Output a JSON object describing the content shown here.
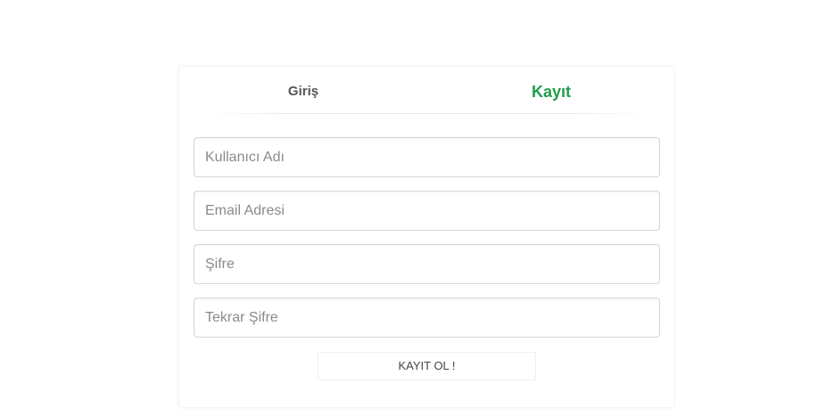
{
  "tabs": {
    "login_label": "Giriş",
    "register_label": "Kayıt",
    "active": "register",
    "active_color": "#1e9e4a"
  },
  "form": {
    "username_placeholder": "Kullanıcı Adı",
    "email_placeholder": "Email Adresi",
    "password_placeholder": "Şifre",
    "password_repeat_placeholder": "Tekrar Şifre",
    "username_value": "",
    "email_value": "",
    "password_value": "",
    "password_repeat_value": "",
    "submit_label": "KAYIT OL !"
  }
}
